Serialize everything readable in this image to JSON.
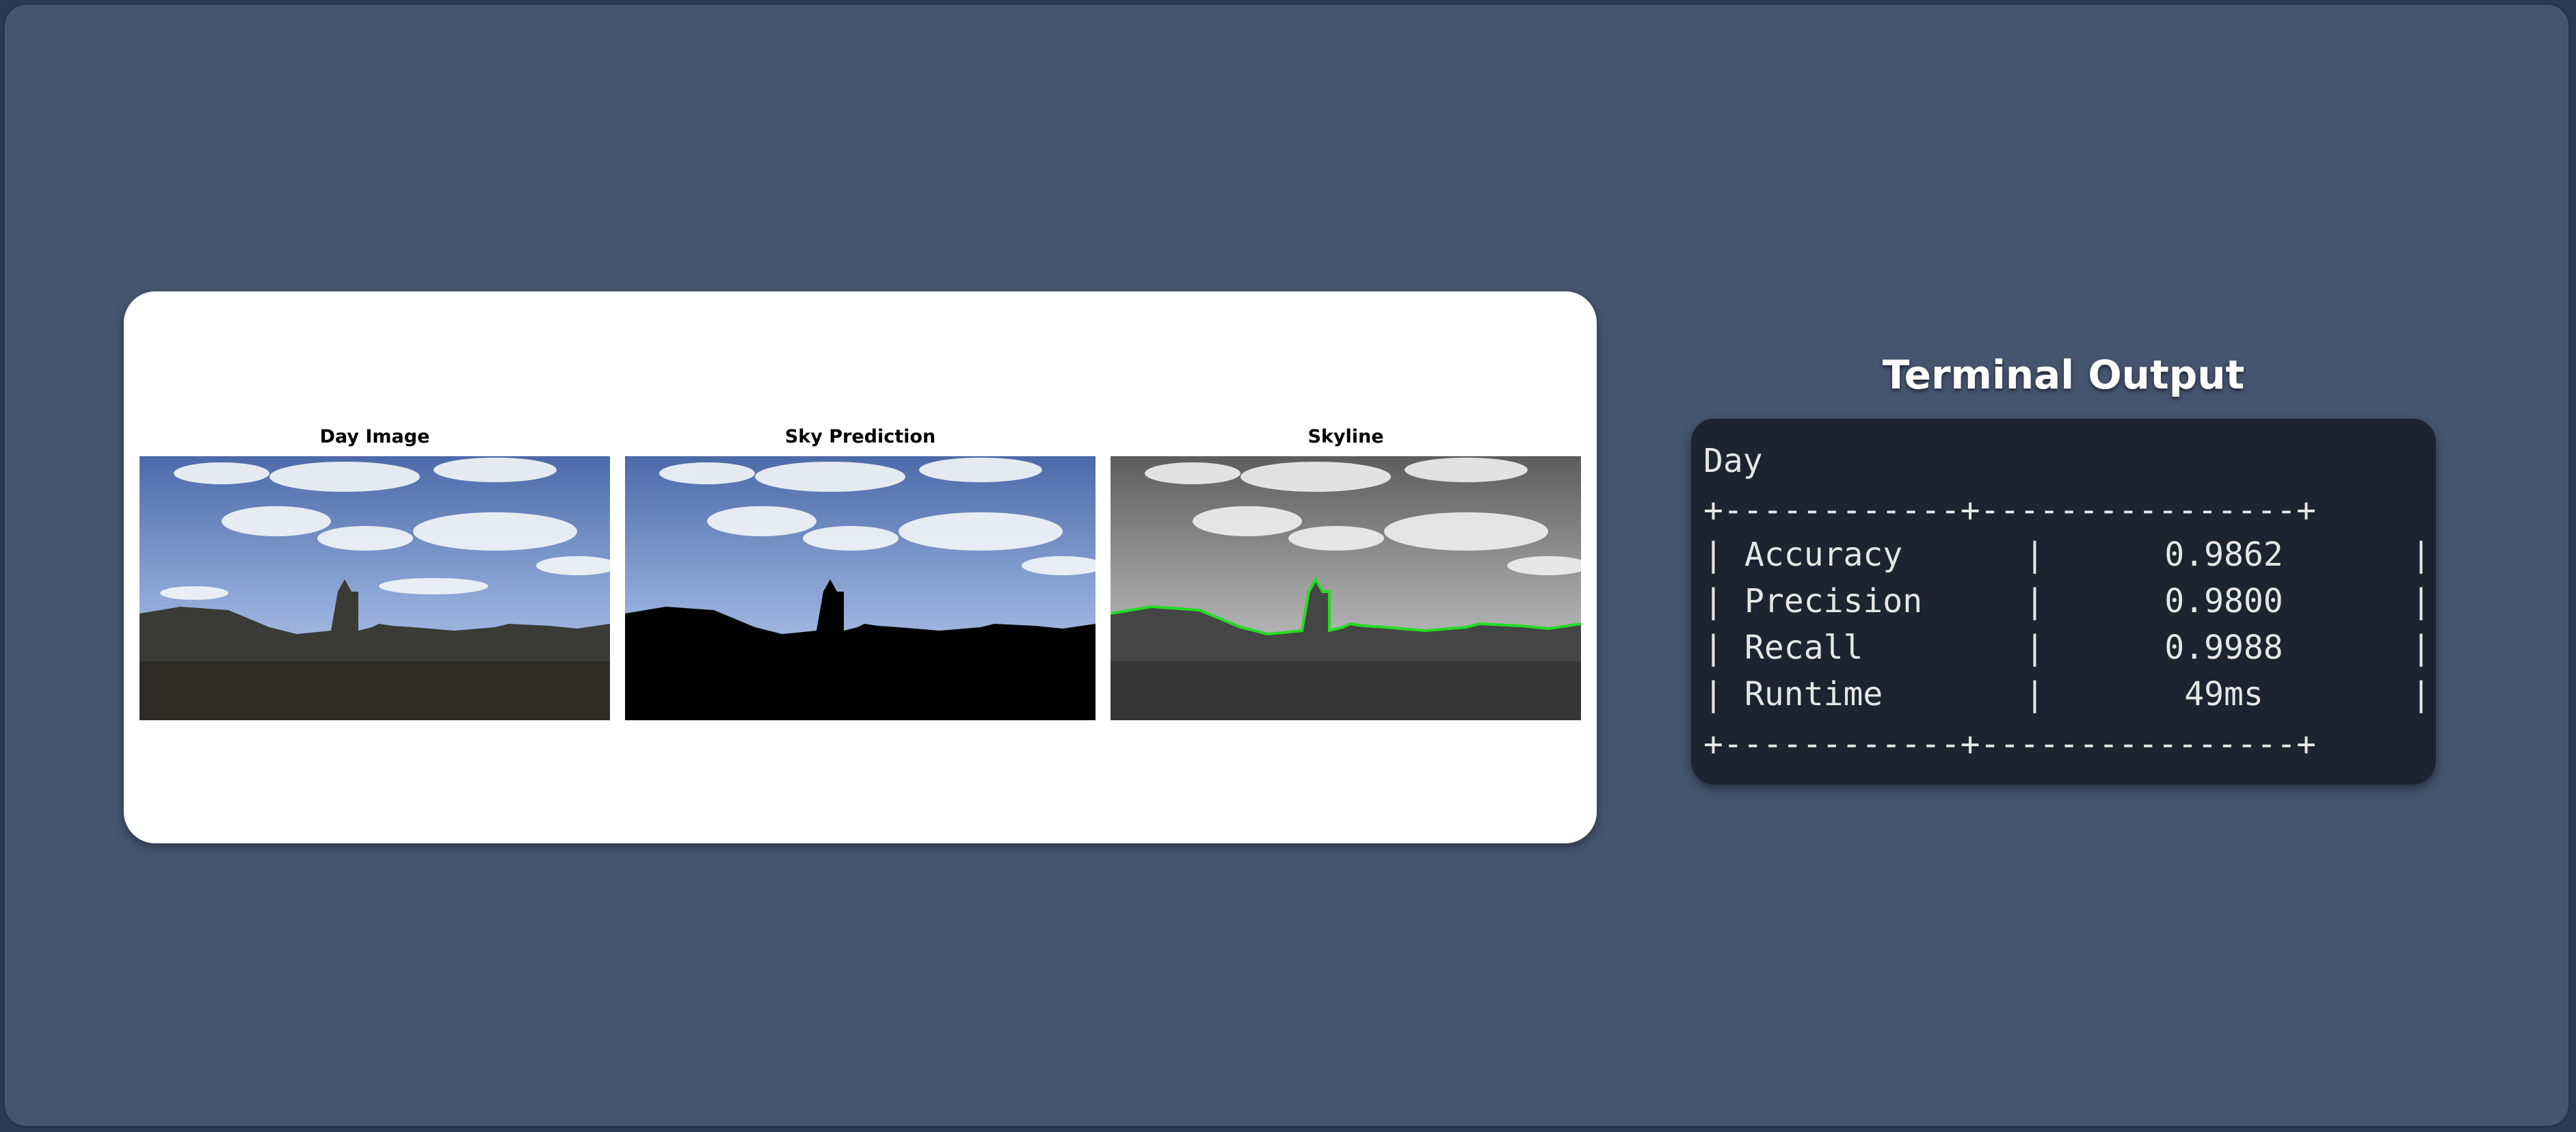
{
  "panel": {
    "images": [
      {
        "title": "Day Image"
      },
      {
        "title": "Sky Prediction"
      },
      {
        "title": "Skyline"
      }
    ]
  },
  "terminal": {
    "title": "Terminal Output",
    "heading": "Day",
    "rule": "+------------+----------------+",
    "pipe": "|",
    "rows": [
      {
        "label": "Accuracy",
        "value": "0.9862"
      },
      {
        "label": "Precision",
        "value": "0.9800"
      },
      {
        "label": "Recall",
        "value": "0.9988"
      },
      {
        "label": "Runtime",
        "value": "49ms"
      }
    ]
  },
  "colors": {
    "background": "#455570",
    "terminal_bg": "#1b2430",
    "skyline": "#22dd22"
  }
}
